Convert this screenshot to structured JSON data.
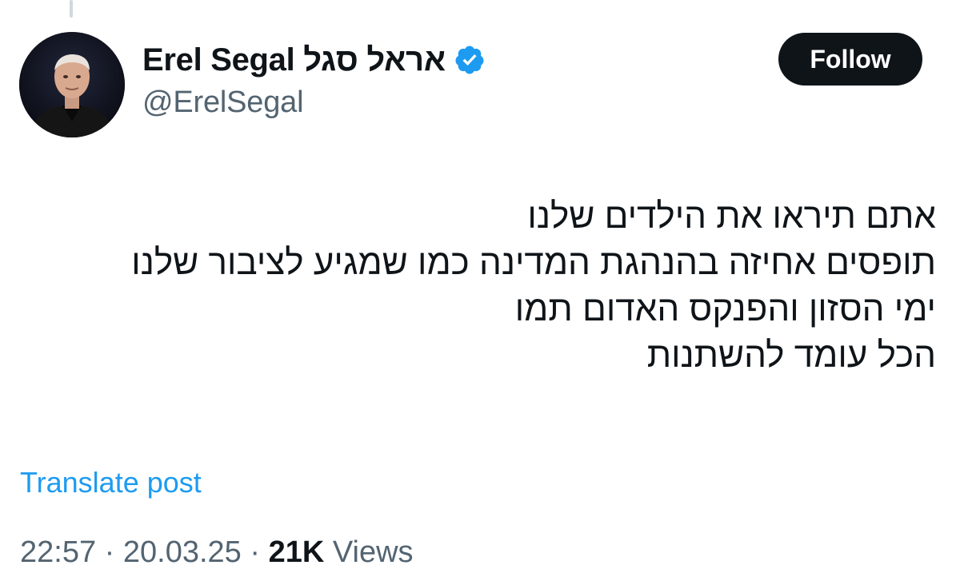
{
  "author": {
    "display_name": "Erel Segal אראל סגל",
    "handle": "@ErelSegal",
    "avatar_icon": "avatar-photo",
    "verified_icon": "verified-badge-icon",
    "verified_color": "#1d9bf0"
  },
  "actions": {
    "follow_label": "Follow"
  },
  "post": {
    "lines": [
      "אתם תיראו את הילדים שלנו",
      "תופסים אחיזה בהנהגת המדינה כמו שמגיע לציבור שלנו",
      "ימי הסזון והפנקס האדום תמו",
      "הכל עומד להשתנות"
    ],
    "translate_label": "Translate post"
  },
  "meta": {
    "time": "22:57",
    "separator": " · ",
    "date": "20.03.25",
    "views_count": "21K",
    "views_label": " Views"
  },
  "colors": {
    "text_primary": "#0f1419",
    "text_secondary": "#536471",
    "link": "#1d9bf0",
    "button_bg": "#0f1419"
  }
}
